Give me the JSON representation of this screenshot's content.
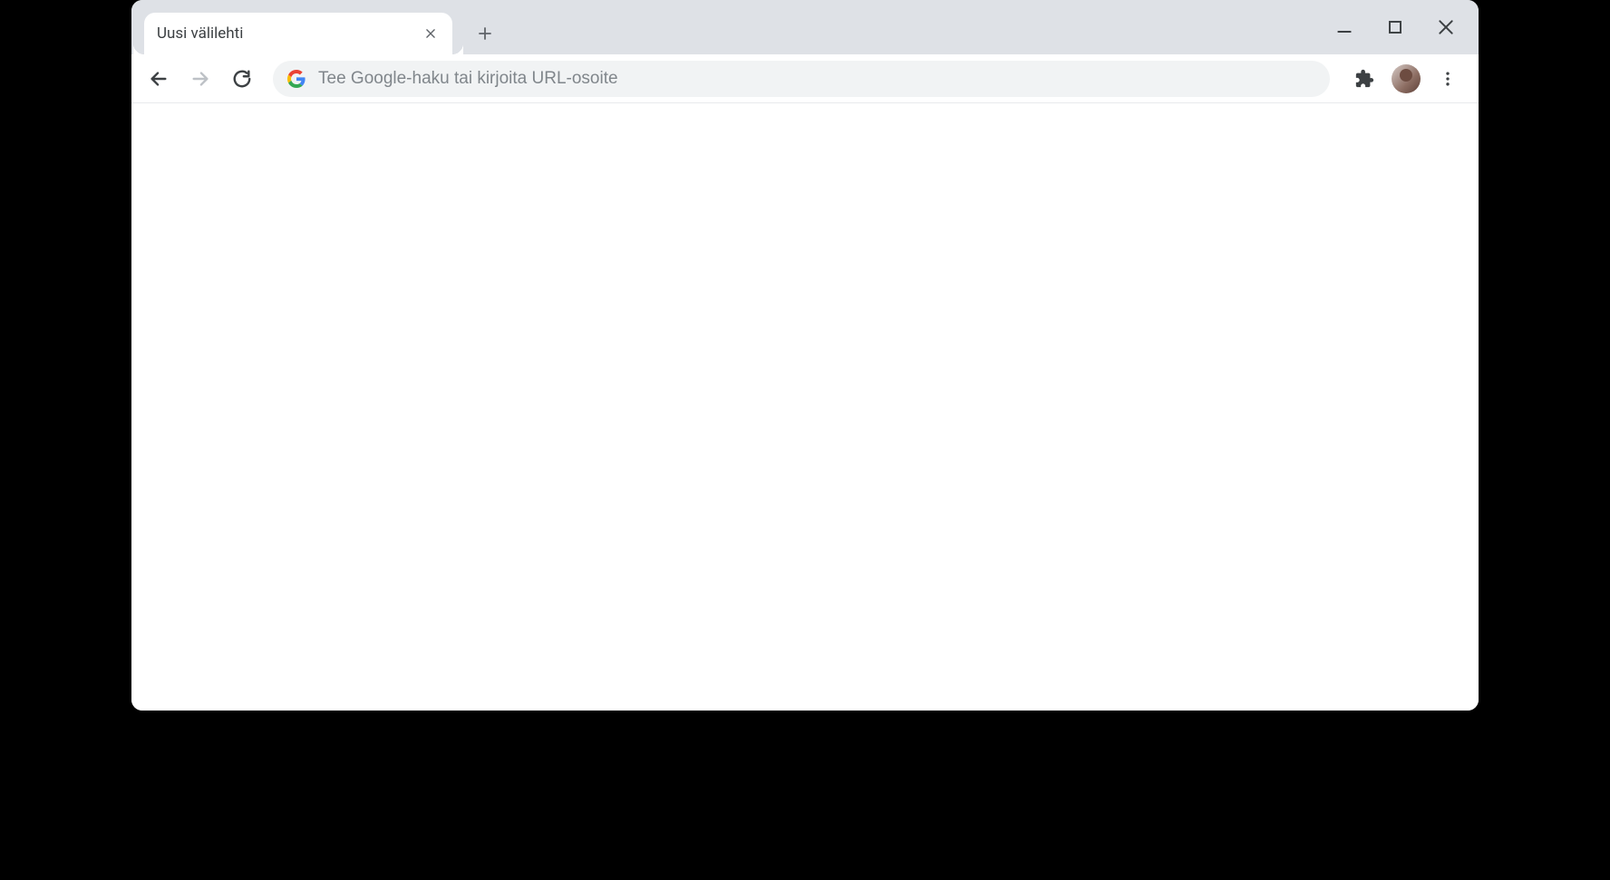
{
  "tab": {
    "title": "Uusi välilehti"
  },
  "omnibox": {
    "placeholder": "Tee Google-haku tai kirjoita URL-osoite",
    "value": ""
  }
}
